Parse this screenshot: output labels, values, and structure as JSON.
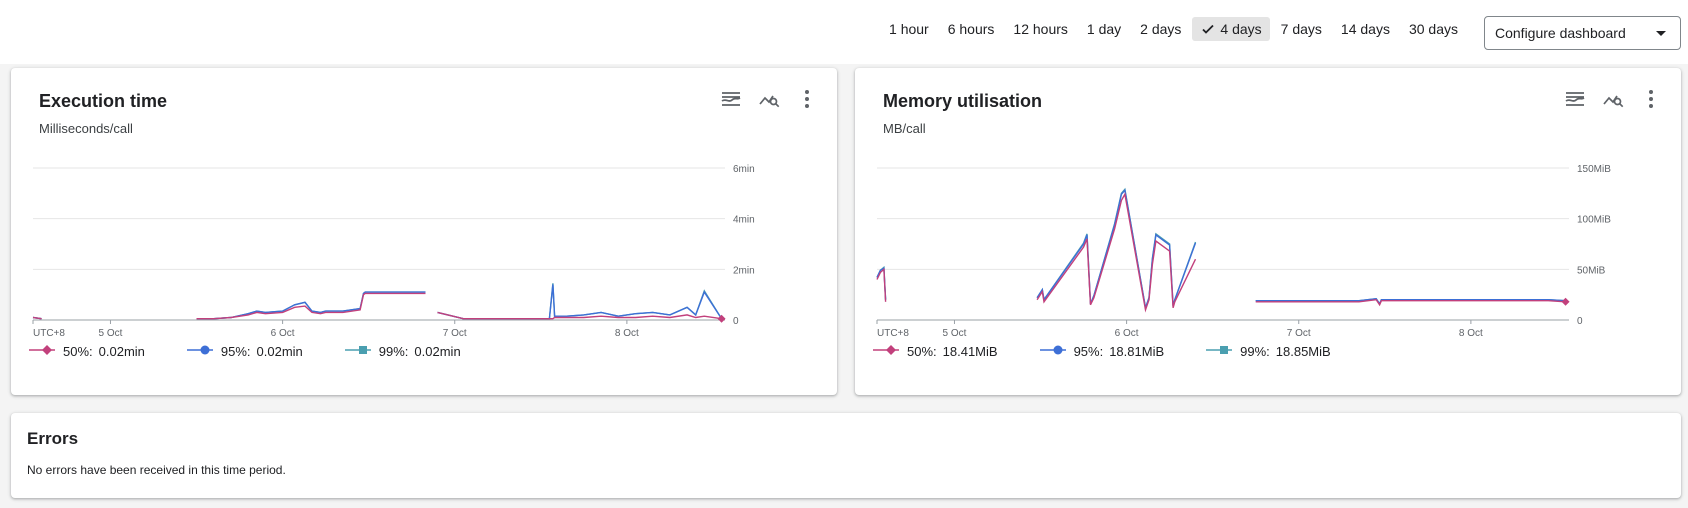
{
  "time_ranges": [
    {
      "label": "1 hour",
      "active": false
    },
    {
      "label": "6 hours",
      "active": false
    },
    {
      "label": "12 hours",
      "active": false
    },
    {
      "label": "1 day",
      "active": false
    },
    {
      "label": "2 days",
      "active": false
    },
    {
      "label": "4 days",
      "active": true
    },
    {
      "label": "7 days",
      "active": false
    },
    {
      "label": "14 days",
      "active": false
    },
    {
      "label": "30 days",
      "active": false
    }
  ],
  "configure_dashboard": "Configure dashboard",
  "colors": {
    "p50": "#c2407c",
    "p95": "#3d6fd6",
    "p99": "#4a9fb0",
    "grid": "#e6e6e6"
  },
  "icons": {
    "legend_toggle": "legend-toggle-icon",
    "explore": "explore-chart-icon",
    "more": "more-vert-icon"
  },
  "execution": {
    "title": "Execution time",
    "subtitle": "Milliseconds/call",
    "legend": [
      {
        "label": "50%:",
        "value": "0.02min",
        "marker": "diamond"
      },
      {
        "label": "95%:",
        "value": "0.02min",
        "marker": "circle"
      },
      {
        "label": "99%:",
        "value": "0.02min",
        "marker": "square"
      }
    ]
  },
  "memory": {
    "title": "Memory utilisation",
    "subtitle": "MB/call",
    "legend": [
      {
        "label": "50%:",
        "value": "18.41MiB",
        "marker": "diamond"
      },
      {
        "label": "95%:",
        "value": "18.81MiB",
        "marker": "circle"
      },
      {
        "label": "99%:",
        "value": "18.85MiB",
        "marker": "square"
      }
    ]
  },
  "errors": {
    "title": "Errors",
    "message": "No errors have been received in this time period."
  },
  "chart_data": [
    {
      "type": "line",
      "ylim": [
        0,
        6
      ],
      "y_ticks": [
        "0",
        "2min",
        "4min",
        "6min"
      ],
      "y_tick_values": [
        0,
        2,
        4,
        6
      ],
      "x_ticks": [
        "UTC+8",
        "5 Oct",
        "6 Oct",
        "7 Oct",
        "8 Oct"
      ],
      "x_tick_values": [
        0,
        0.45,
        1.45,
        2.45,
        3.45
      ],
      "xlim": [
        0,
        4.02
      ],
      "series": [
        {
          "name": "50%",
          "color": "#c2407c",
          "x": [
            0,
            0.05,
            0.06,
            0.95,
            1.05,
            1.15,
            1.25,
            1.3,
            1.35,
            1.45,
            1.52,
            1.58,
            1.62,
            1.67,
            1.7,
            1.8,
            1.9,
            1.92,
            1.93,
            2.15,
            2.28,
            2.29,
            2.35,
            2.5,
            2.6,
            2.7,
            2.8,
            2.9,
            3.0,
            3.02,
            3.03,
            3.1,
            3.2,
            3.3,
            3.4,
            3.5,
            3.6,
            3.7,
            3.8,
            3.85,
            3.9,
            4.0
          ],
          "y": [
            0.1,
            0.05,
            null,
            0.05,
            0.05,
            0.1,
            0.2,
            0.3,
            0.25,
            0.3,
            0.5,
            0.55,
            0.3,
            0.25,
            0.3,
            0.3,
            0.4,
            1.0,
            1.05,
            1.05,
            1.05,
            null,
            0.3,
            0.05,
            0.05,
            0.05,
            0.05,
            0.05,
            0.05,
            0.05,
            0.1,
            0.1,
            0.1,
            0.15,
            0.1,
            0.1,
            0.15,
            0.1,
            0.2,
            0.1,
            0.15,
            0.05
          ]
        },
        {
          "name": "95%",
          "color": "#3d6fd6",
          "x": [
            0,
            0.05,
            0.06,
            0.95,
            1.05,
            1.15,
            1.25,
            1.3,
            1.35,
            1.45,
            1.52,
            1.58,
            1.62,
            1.67,
            1.7,
            1.8,
            1.9,
            1.92,
            1.93,
            2.15,
            2.28,
            2.29,
            2.35,
            2.5,
            2.6,
            2.7,
            2.8,
            2.9,
            3.0,
            3.02,
            3.03,
            3.1,
            3.2,
            3.3,
            3.4,
            3.5,
            3.6,
            3.7,
            3.8,
            3.85,
            3.9,
            4.0
          ],
          "y": [
            0.1,
            0.05,
            null,
            0.05,
            0.05,
            0.1,
            0.25,
            0.35,
            0.3,
            0.35,
            0.6,
            0.7,
            0.35,
            0.3,
            0.35,
            0.35,
            0.45,
            1.05,
            1.1,
            1.1,
            1.1,
            null,
            0.3,
            0.05,
            0.05,
            0.05,
            0.05,
            0.05,
            0.05,
            1.4,
            0.15,
            0.15,
            0.2,
            0.3,
            0.15,
            0.25,
            0.3,
            0.2,
            0.5,
            0.2,
            1.1,
            0.05
          ]
        },
        {
          "name": "99%",
          "color": "#4a9fb0",
          "x": [
            0,
            0.05,
            0.06,
            0.95,
            1.05,
            1.15,
            1.25,
            1.3,
            1.35,
            1.45,
            1.52,
            1.58,
            1.62,
            1.67,
            1.7,
            1.8,
            1.9,
            1.92,
            1.93,
            2.15,
            2.28,
            2.29,
            2.35,
            2.5,
            2.6,
            2.7,
            2.8,
            2.9,
            3.0,
            3.02,
            3.03,
            3.1,
            3.2,
            3.3,
            3.4,
            3.5,
            3.6,
            3.7,
            3.8,
            3.85,
            3.9,
            4.0
          ],
          "y": [
            0.1,
            0.05,
            null,
            0.05,
            0.05,
            0.1,
            0.25,
            0.35,
            0.3,
            0.35,
            0.6,
            0.7,
            0.35,
            0.3,
            0.35,
            0.35,
            0.45,
            1.05,
            1.1,
            1.1,
            1.1,
            null,
            0.3,
            0.05,
            0.05,
            0.05,
            0.05,
            0.05,
            0.05,
            1.45,
            0.15,
            0.15,
            0.2,
            0.3,
            0.15,
            0.25,
            0.3,
            0.2,
            0.5,
            0.2,
            1.15,
            0.05
          ]
        }
      ]
    },
    {
      "type": "line",
      "ylim": [
        0,
        150
      ],
      "y_ticks": [
        "0",
        "50MiB",
        "100MiB",
        "150MiB"
      ],
      "y_tick_values": [
        0,
        50,
        100,
        150
      ],
      "x_ticks": [
        "UTC+8",
        "5 Oct",
        "6 Oct",
        "7 Oct",
        "8 Oct"
      ],
      "x_tick_values": [
        0,
        0.45,
        1.45,
        2.45,
        3.45
      ],
      "xlim": [
        0,
        4.02
      ],
      "series": [
        {
          "name": "50%",
          "color": "#c2407c",
          "x": [
            0,
            0.02,
            0.04,
            0.05,
            0.06,
            0.93,
            0.96,
            0.97,
            1.2,
            1.22,
            1.24,
            1.26,
            1.38,
            1.4,
            1.42,
            1.44,
            1.56,
            1.58,
            1.6,
            1.62,
            1.7,
            1.72,
            1.73,
            1.85,
            1.86,
            2.2,
            2.5,
            2.8,
            2.9,
            2.92,
            2.93,
            3.5,
            3.9,
            4.0
          ],
          "y": [
            40,
            47,
            50,
            18,
            null,
            20,
            28,
            18,
            72,
            80,
            15,
            22,
            90,
            104,
            118,
            124,
            10,
            20,
            55,
            78,
            68,
            12,
            18,
            60,
            null,
            18,
            18,
            18,
            20,
            15,
            19,
            19,
            19,
            18
          ]
        },
        {
          "name": "95%",
          "color": "#3d6fd6",
          "x": [
            0,
            0.02,
            0.04,
            0.05,
            0.06,
            0.93,
            0.96,
            0.97,
            1.2,
            1.22,
            1.24,
            1.26,
            1.38,
            1.4,
            1.42,
            1.44,
            1.56,
            1.58,
            1.6,
            1.62,
            1.7,
            1.72,
            1.73,
            1.85,
            1.86,
            2.2,
            2.5,
            2.8,
            2.9,
            2.92,
            2.93,
            3.5,
            3.9,
            4.0
          ],
          "y": [
            42,
            49,
            51,
            20,
            null,
            22,
            30,
            20,
            75,
            84,
            16,
            24,
            94,
            109,
            124,
            128,
            12,
            22,
            60,
            84,
            74,
            14,
            20,
            76,
            null,
            19,
            19,
            19,
            21,
            16,
            20,
            20,
            20,
            19
          ]
        },
        {
          "name": "99%",
          "color": "#4a9fb0",
          "x": [
            0,
            0.02,
            0.04,
            0.05,
            0.06,
            0.93,
            0.96,
            0.97,
            1.2,
            1.22,
            1.24,
            1.26,
            1.38,
            1.4,
            1.42,
            1.44,
            1.56,
            1.58,
            1.6,
            1.62,
            1.7,
            1.72,
            1.73,
            1.85,
            1.86,
            2.2,
            2.5,
            2.8,
            2.9,
            2.92,
            2.93,
            3.5,
            3.9,
            4.0
          ],
          "y": [
            42,
            49,
            52,
            20,
            null,
            22,
            30,
            20,
            76,
            85,
            16,
            24,
            95,
            110,
            125,
            129,
            12,
            22,
            61,
            85,
            75,
            14,
            20,
            77,
            null,
            19,
            19,
            19,
            21,
            16,
            20,
            20,
            20,
            19
          ]
        }
      ]
    }
  ]
}
